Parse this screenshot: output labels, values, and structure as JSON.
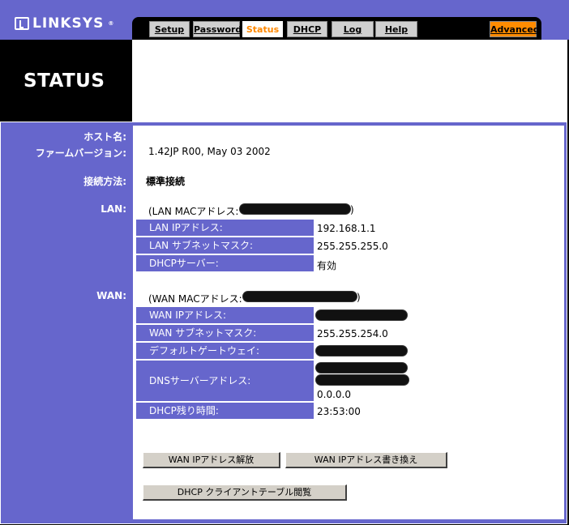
{
  "brand": {
    "name": "LINKSYS",
    "reg": "®"
  },
  "tabs": [
    {
      "label": "Setup",
      "active": false
    },
    {
      "label": "Password",
      "active": false
    },
    {
      "label": "Status",
      "active": true
    },
    {
      "label": "DHCP",
      "active": false
    },
    {
      "label": "Log",
      "active": false
    },
    {
      "label": "Help",
      "active": false
    }
  ],
  "advanced_tab": "Advanced",
  "page_title": "STATUS",
  "labels": {
    "host_name": "ホスト名:",
    "firmware": "ファームバージョン:",
    "connection": "接続方法:",
    "lan": "LAN:",
    "wan": "WAN:"
  },
  "values": {
    "host_name": "",
    "firmware": "1.42JP R00, May 03 2002",
    "connection": "標準接続"
  },
  "lan": {
    "mac_prefix": "(LAN MACアドレス:",
    "mac_suffix": ")",
    "rows": [
      {
        "label": "LAN IPアドレス:",
        "value": "192.168.1.1"
      },
      {
        "label": "LAN サブネットマスク:",
        "value": "255.255.255.0"
      },
      {
        "label": "DHCPサーバー:",
        "value": "有効"
      }
    ]
  },
  "wan": {
    "mac_prefix": "(WAN MACアドレス:",
    "mac_suffix": ")",
    "rows": [
      {
        "label": "WAN IPアドレス:",
        "value": ""
      },
      {
        "label": "WAN サブネットマスク:",
        "value": "255.255.254.0"
      },
      {
        "label": "デフォルトゲートウェイ:",
        "value": ""
      },
      {
        "label": "DNSサーバーアドレス:",
        "value": "0.0.0.0"
      },
      {
        "label": "DHCP残り時間:",
        "value": "23:53:00"
      }
    ]
  },
  "buttons": {
    "release": "WAN IPアドレス解放",
    "renew": "WAN IPアドレス書き換え",
    "dhcp_table": "DHCP クライアントテーブル閲覧"
  },
  "colors": {
    "header_blue": "#6666cc",
    "active_tab_text": "#ff8800",
    "advanced_tab_bg": "#ff8c00"
  }
}
